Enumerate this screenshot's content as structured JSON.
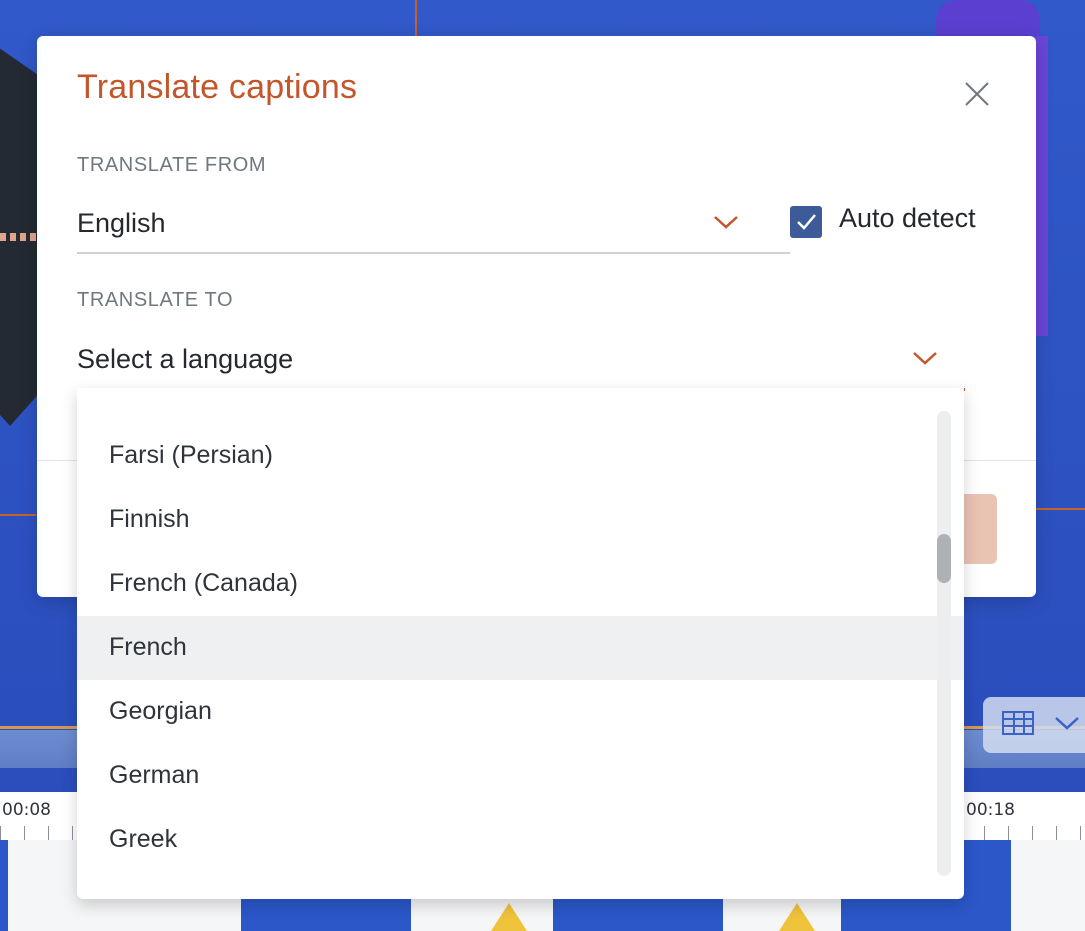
{
  "dialog": {
    "title": "Translate captions",
    "close_icon": "close-icon"
  },
  "translate_from": {
    "label": "TRANSLATE FROM",
    "value": "English",
    "auto_detect_label": "Auto detect",
    "auto_detect_checked": true
  },
  "translate_to": {
    "label": "TRANSLATE TO",
    "placeholder": "Select a language"
  },
  "language_options": [
    {
      "label": "Farsi (Persian)",
      "highlighted": false
    },
    {
      "label": "Finnish",
      "highlighted": false
    },
    {
      "label": "French (Canada)",
      "highlighted": false
    },
    {
      "label": "French",
      "highlighted": true
    },
    {
      "label": "Georgian",
      "highlighted": false
    },
    {
      "label": "German",
      "highlighted": false
    },
    {
      "label": "Greek",
      "highlighted": false
    }
  ],
  "timeline": {
    "time_left": "00:08",
    "time_right": "00:18"
  },
  "colors": {
    "accent": "#c3562a",
    "checkbox": "#3d5a99",
    "background": "#2f55c4"
  }
}
